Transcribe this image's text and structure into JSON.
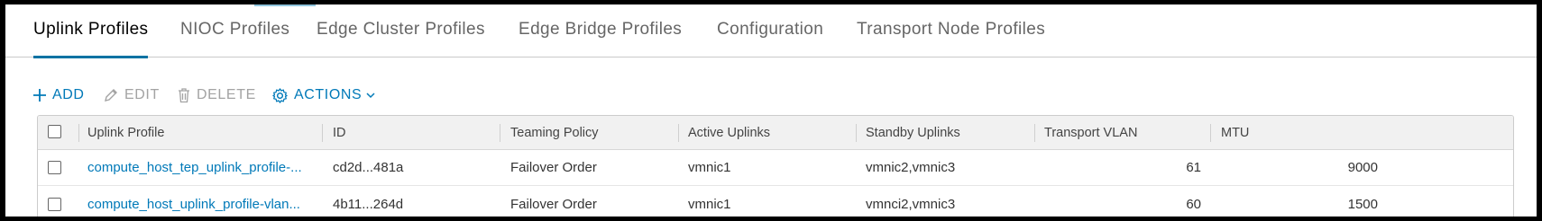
{
  "tabs": [
    {
      "label": "Uplink Profiles",
      "active": true
    },
    {
      "label": "NIOC Profiles"
    },
    {
      "label": "Edge Cluster Profiles"
    },
    {
      "label": "Edge Bridge Profiles"
    },
    {
      "label": "Configuration"
    },
    {
      "label": "Transport Node Profiles"
    }
  ],
  "toolbar": {
    "add_label": "ADD",
    "edit_label": "EDIT",
    "delete_label": "DELETE",
    "actions_label": "ACTIONS"
  },
  "table": {
    "columns": [
      "Uplink Profile",
      "ID",
      "Teaming Policy",
      "Active Uplinks",
      "Standby Uplinks",
      "Transport VLAN",
      "MTU"
    ],
    "rows": [
      [
        "compute_host_tep_uplink_profile-...",
        "cd2d...481a",
        "Failover Order",
        "vmnic1",
        "vmnic2,vmnic3",
        "61",
        "9000"
      ],
      [
        "compute_host_uplink_profile-vlan...",
        "4b11...264d",
        "Failover Order",
        "vmnic1",
        "vmnci2,vmnic3",
        "60",
        "1500"
      ]
    ]
  },
  "colors": {
    "accent": "#0079b8",
    "active_tab_underline": "#0072a3",
    "disabled": "#a3a3a3",
    "header_bg": "#f1f1f1"
  },
  "icons": {
    "add": "plus-icon",
    "edit": "pencil-icon",
    "delete": "trash-icon",
    "actions": "gear-icon",
    "actions_caret": "chevron-down-icon"
  }
}
